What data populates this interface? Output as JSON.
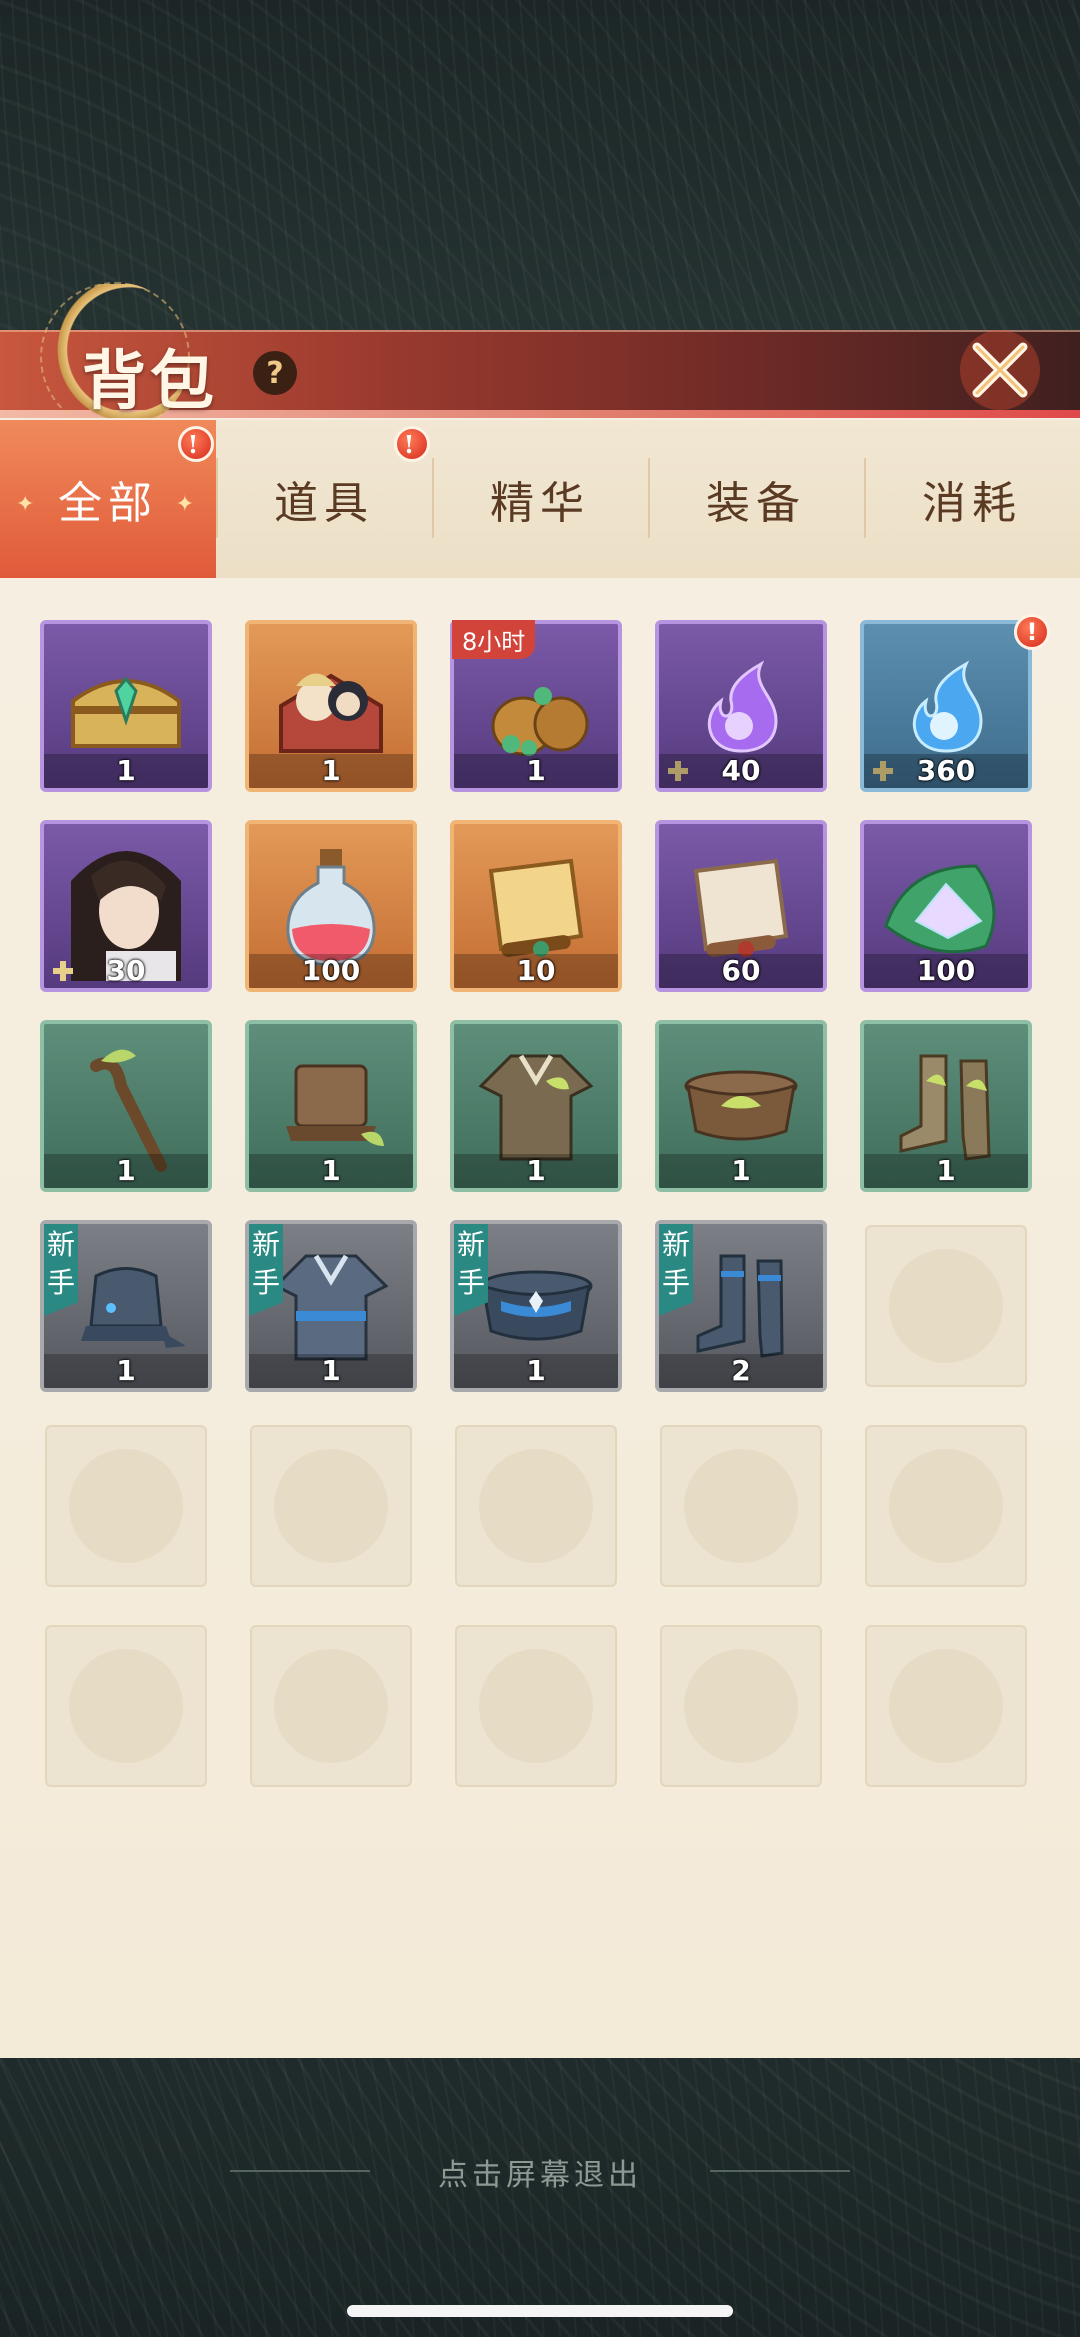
{
  "header": {
    "title": "背包",
    "help": "?",
    "close_icon": "close-x-icon"
  },
  "tabs": [
    {
      "label": "全部",
      "active": true,
      "alert": true
    },
    {
      "label": "道具",
      "active": false,
      "alert": true
    },
    {
      "label": "精华",
      "active": false,
      "alert": false
    },
    {
      "label": "装备",
      "active": false,
      "alert": false
    },
    {
      "label": "消耗",
      "active": false,
      "alert": false
    }
  ],
  "alert_mark": "!",
  "items": [
    {
      "icon": "treasure-chest-icon",
      "rarity": "purple",
      "count": "1"
    },
    {
      "icon": "character-box-icon",
      "rarity": "orange",
      "count": "1"
    },
    {
      "icon": "money-bag-icon",
      "rarity": "purple",
      "count": "1",
      "timer": "8小时"
    },
    {
      "icon": "purple-flame-icon",
      "rarity": "purple",
      "count": "40",
      "shard": true
    },
    {
      "icon": "blue-flame-icon",
      "rarity": "blue",
      "count": "360",
      "shard": true,
      "alert": true
    },
    {
      "icon": "hero-portrait-icon",
      "rarity": "purple",
      "count": "30",
      "shard": true
    },
    {
      "icon": "red-potion-icon",
      "rarity": "orange",
      "count": "100"
    },
    {
      "icon": "golden-scroll-icon",
      "rarity": "orange",
      "count": "10"
    },
    {
      "icon": "white-scroll-icon",
      "rarity": "purple",
      "count": "60"
    },
    {
      "icon": "crystal-leaf-icon",
      "rarity": "purple",
      "count": "100"
    },
    {
      "icon": "wooden-staff-icon",
      "rarity": "green",
      "count": "1"
    },
    {
      "icon": "leather-hat-icon",
      "rarity": "green",
      "count": "1"
    },
    {
      "icon": "leaf-robe-icon",
      "rarity": "green",
      "count": "1"
    },
    {
      "icon": "leaf-belt-icon",
      "rarity": "green",
      "count": "1"
    },
    {
      "icon": "leaf-boots-icon",
      "rarity": "green",
      "count": "1"
    },
    {
      "icon": "blue-hat-icon",
      "rarity": "gray",
      "count": "1",
      "novice": "新手"
    },
    {
      "icon": "blue-robe-icon",
      "rarity": "gray",
      "count": "1",
      "novice": "新手"
    },
    {
      "icon": "blue-belt-icon",
      "rarity": "gray",
      "count": "1",
      "novice": "新手"
    },
    {
      "icon": "blue-boots-icon",
      "rarity": "gray",
      "count": "2",
      "novice": "新手"
    }
  ],
  "empty_slots": 11,
  "footer": {
    "hint": "点击屏幕退出"
  }
}
